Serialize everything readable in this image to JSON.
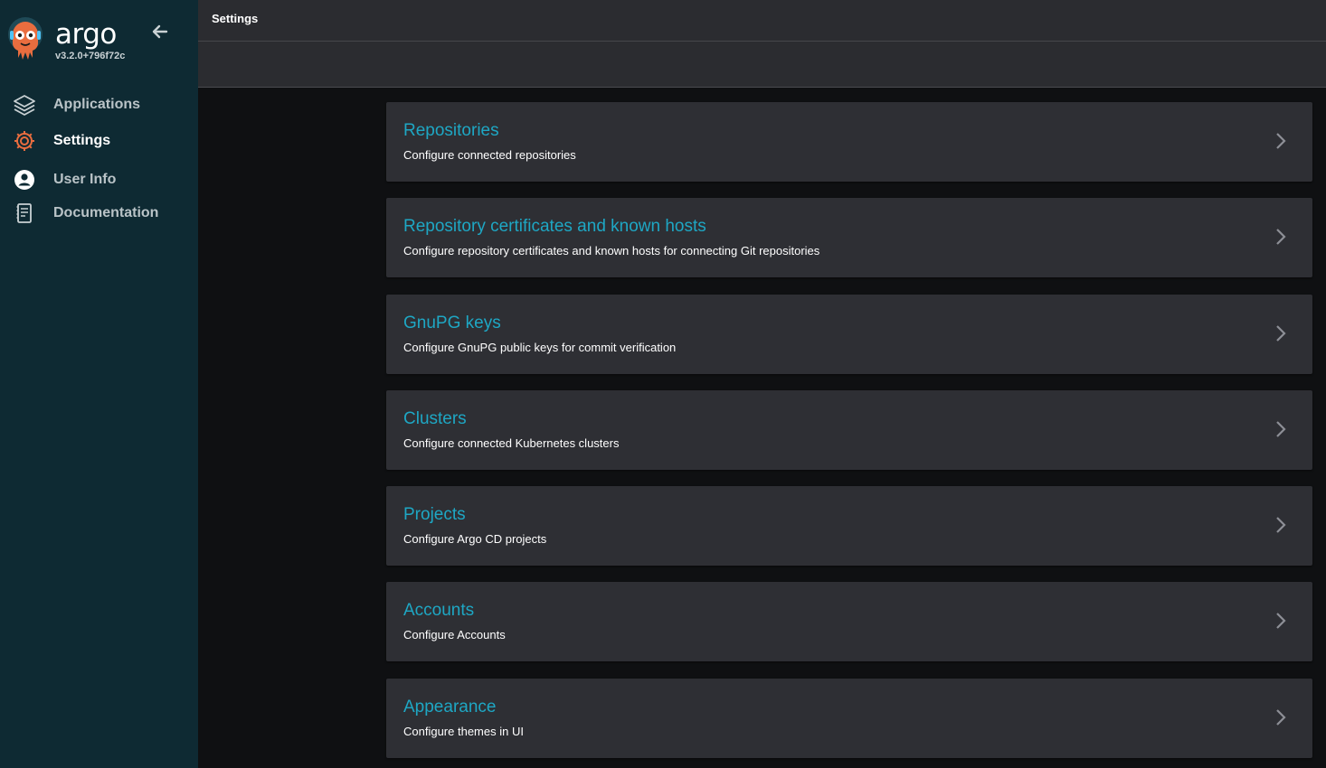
{
  "brand": {
    "name": "argo",
    "version": "v3.2.0+796f72c"
  },
  "colors": {
    "sidebar_bg": "#0e2a33",
    "accent": "#1ea7c4",
    "card_bg": "#2e2f34",
    "page_bg": "#0f1012"
  },
  "sidebar": {
    "collapse_icon": "arrow-left-icon",
    "items": [
      {
        "label": "Applications",
        "icon": "layers-icon"
      },
      {
        "label": "Settings",
        "icon": "gear-icon",
        "active": true
      },
      {
        "label": "User Info",
        "icon": "user-circle-icon"
      },
      {
        "label": "Documentation",
        "icon": "book-icon"
      }
    ]
  },
  "header": {
    "title": "Settings"
  },
  "settings": {
    "cards": [
      {
        "title": "Repositories",
        "description": "Configure connected repositories"
      },
      {
        "title": "Repository certificates and known hosts",
        "description": "Configure repository certificates and known hosts for connecting Git repositories"
      },
      {
        "title": "GnuPG keys",
        "description": "Configure GnuPG public keys for commit verification"
      },
      {
        "title": "Clusters",
        "description": "Configure connected Kubernetes clusters"
      },
      {
        "title": "Projects",
        "description": "Configure Argo CD projects"
      },
      {
        "title": "Accounts",
        "description": "Configure Accounts"
      },
      {
        "title": "Appearance",
        "description": "Configure themes in UI"
      }
    ]
  }
}
